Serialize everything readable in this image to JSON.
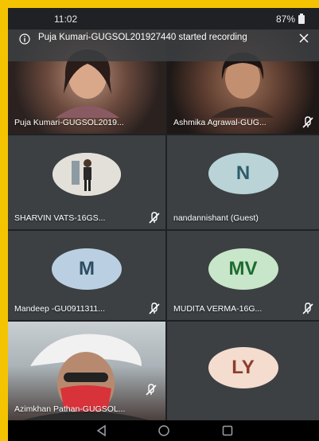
{
  "status_bar": {
    "time": "11:02",
    "battery": "87%"
  },
  "notification": {
    "message": "Puja Kumari-GUGSOL201927440 started recording",
    "icons": [
      "info-icon",
      "close-icon"
    ]
  },
  "participants": [
    {
      "name": "Puja Kumari-GUGSOL2019...",
      "type": "video",
      "muted": false
    },
    {
      "name": "Ashmika Agrawal-GUG...",
      "type": "video",
      "muted": true
    },
    {
      "name": "SHARVIN VATS-16GS...",
      "type": "photo",
      "muted": true
    },
    {
      "name": "nandannishant (Guest)",
      "type": "initials",
      "initials": "N",
      "avatar_color": "#b9d3d7",
      "text_color": "#2d5d6b",
      "muted": false
    },
    {
      "name": "Mandeep -GU0911311...",
      "type": "initials",
      "initials": "M",
      "avatar_color": "#bad0e2",
      "text_color": "#2d4c60",
      "muted": true
    },
    {
      "name": "MUDITA VERMA-16G...",
      "type": "initials",
      "initials": "MV",
      "avatar_color": "#c8e6c9",
      "text_color": "#1f6a2f",
      "muted": true
    },
    {
      "name": "Azimkhan Pathan-GUGSOL...",
      "type": "video",
      "muted": true
    },
    {
      "name": "",
      "type": "initials",
      "initials": "LY",
      "avatar_color": "#f4dccf",
      "text_color": "#8c3d2a",
      "muted": false
    }
  ],
  "nav_buttons": [
    "back-icon",
    "home-icon",
    "recents-icon"
  ]
}
